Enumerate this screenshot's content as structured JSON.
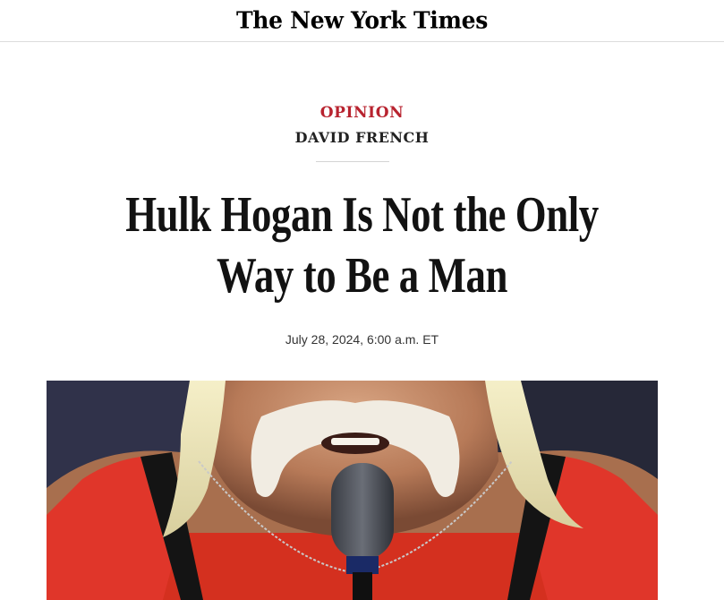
{
  "masthead": {
    "logo_text": "The New York Times"
  },
  "article": {
    "section": "OPINION",
    "author": "DAVID FRENCH",
    "headline": "Hulk Hogan Is Not the Only Way to Be a Man",
    "dateline": "July 28, 2024, 6:00 a.m. ET"
  },
  "photo": {
    "subject": "man-with-white-mustache-speaking-into-microphone"
  },
  "colors": {
    "section_red": "#b8232f",
    "text": "#121212",
    "divider": "#d4d4d4"
  }
}
